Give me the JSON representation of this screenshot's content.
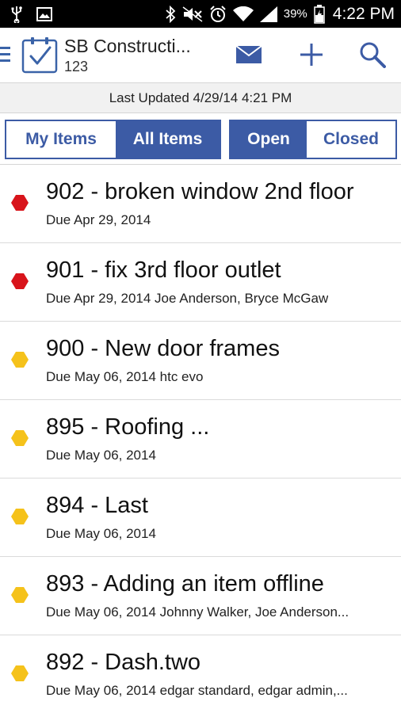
{
  "status_bar": {
    "battery_percent": "39%",
    "time": "4:22 PM",
    "icons": [
      "usb-icon",
      "image-icon",
      "bluetooth-icon",
      "mute-icon",
      "alarm-icon",
      "wifi-icon",
      "signal-icon",
      "battery-icon"
    ]
  },
  "app_bar": {
    "title": "SB Constructi...",
    "subtitle": "123",
    "icons": [
      "menu-icon",
      "checklist-logo-icon",
      "mail-icon",
      "add-icon",
      "search-icon"
    ],
    "accent_color": "#3c5ba5"
  },
  "last_updated": "Last Updated 4/29/14 4:21 PM",
  "filters": {
    "scope": [
      {
        "label": "My Items",
        "active": false
      },
      {
        "label": "All Items",
        "active": true
      }
    ],
    "state": [
      {
        "label": "Open",
        "active": true
      },
      {
        "label": "Closed",
        "active": false
      }
    ]
  },
  "status_colors": {
    "overdue": "#d8141b",
    "upcoming": "#f5c21b"
  },
  "items": [
    {
      "title": "902 - broken window 2nd floor",
      "subtitle": "Due Apr 29, 2014",
      "status": "overdue"
    },
    {
      "title": "901 - fix 3rd floor outlet",
      "subtitle": "Due Apr 29, 2014 Joe Anderson, Bryce McGaw",
      "status": "overdue"
    },
    {
      "title": "900 - New door frames",
      "subtitle": "Due May 06, 2014 htc evo",
      "status": "upcoming"
    },
    {
      "title": "895 - Roofing ...",
      "subtitle": "Due May 06, 2014",
      "status": "upcoming"
    },
    {
      "title": "894 - Last",
      "subtitle": "Due May 06, 2014",
      "status": "upcoming"
    },
    {
      "title": "893 - Adding an item offline",
      "subtitle": "Due May 06, 2014 Johnny Walker, Joe Anderson...",
      "status": "upcoming"
    },
    {
      "title": "892 - Dash.two",
      "subtitle": "Due May 06, 2014 edgar standard, edgar admin,...",
      "status": "upcoming"
    }
  ]
}
